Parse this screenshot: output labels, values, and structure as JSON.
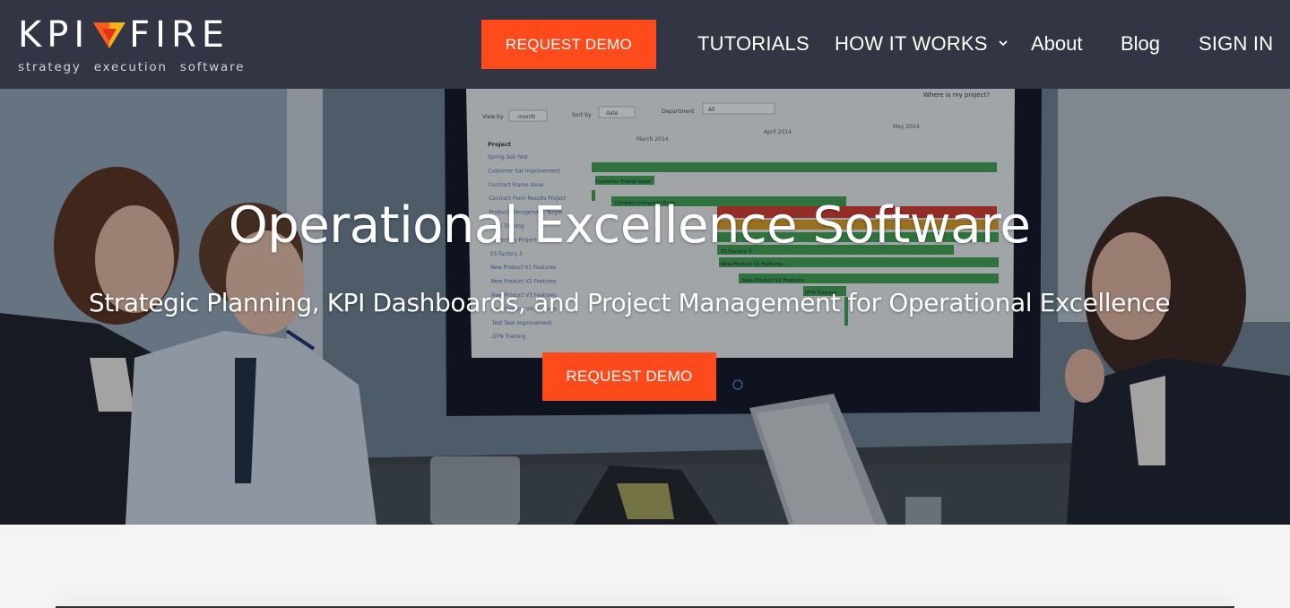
{
  "brand": {
    "wordmark_left": "KPI",
    "wordmark_right": "FIRE",
    "tagline": "strategy execution software",
    "logo_mark_icon": "flame-triangle-icon",
    "colors": {
      "navbar": "#323644",
      "accent": "#ff4a1c"
    }
  },
  "nav": {
    "request_demo": "REQUEST DEMO",
    "tutorials": "TUTORIALS",
    "how_it_works": "HOW IT WORKS",
    "how_it_works_icon": "chevron-down-icon",
    "about": "About",
    "blog": "Blog",
    "sign_in": "SIGN IN"
  },
  "hero": {
    "title": "Operational Excellence Software",
    "subtitle": "Strategic Planning, KPI Dashboards, and Project Management for Operational Excellence",
    "cta": "REQUEST DEMO",
    "screen": {
      "header_label": "Where is my project?",
      "view_by_label": "View by",
      "view_by_value": "month",
      "sort_by_label": "Sort by",
      "sort_by_value": "date",
      "department_label": "Department",
      "department_value": "All",
      "months": [
        "March 2014",
        "April 2014",
        "May 2014"
      ],
      "project_header": "Project",
      "projects": [
        "Spring Sell Yoid",
        "Customer Sat Improvement",
        "Contract Frame Issue",
        "Contract Form Results Project",
        "Product Management Target",
        "Lean Training",
        "5S Factory Project",
        "5S Factory 3",
        "New Product V1 Features",
        "New Product V2 Features",
        "New Product V3 Features",
        "New Product V4 Features",
        "Test Task Improvement",
        "DTN Training"
      ],
      "bar_labels": [
        "Customer Frame Issue",
        "Contract Complete Expo",
        "5S Factory 3",
        "New Product V1 Features",
        "New Product V2 Features",
        "DTN Training"
      ]
    }
  }
}
